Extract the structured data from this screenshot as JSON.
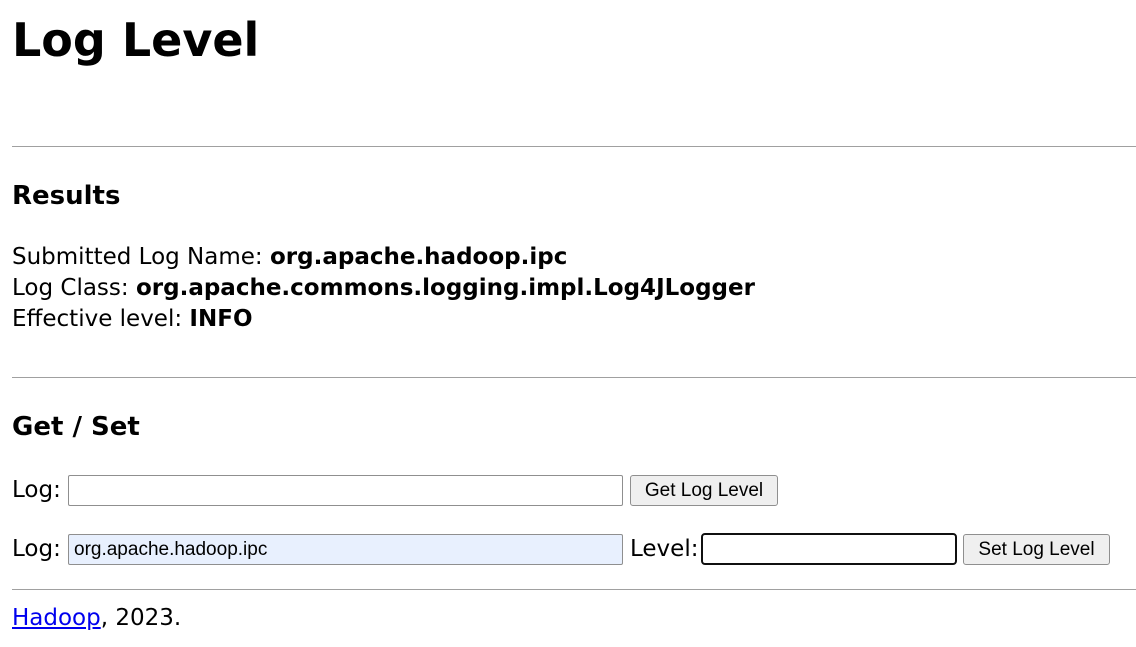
{
  "page": {
    "title": "Log Level"
  },
  "results": {
    "heading": "Results",
    "submitted_label": "Submitted Log Name:",
    "submitted_value": "org.apache.hadoop.ipc",
    "class_label": "Log Class:",
    "class_value": "org.apache.commons.logging.impl.Log4JLogger",
    "level_label": "Effective level:",
    "level_value": "INFO"
  },
  "get_set": {
    "heading": "Get / Set",
    "get_form": {
      "log_label": "Log:",
      "log_value": "",
      "button_label": "Get Log Level"
    },
    "set_form": {
      "log_label": "Log:",
      "log_value": "org.apache.hadoop.ipc",
      "level_label": "Level:",
      "level_value": "",
      "button_label": "Set Log Level"
    }
  },
  "footer": {
    "link_text": "Hadoop",
    "suffix": ", 2023."
  },
  "colors": {
    "link": "#0000ee",
    "autofill_bg": "#e8f0fe",
    "rule": "#a0a0a0"
  }
}
